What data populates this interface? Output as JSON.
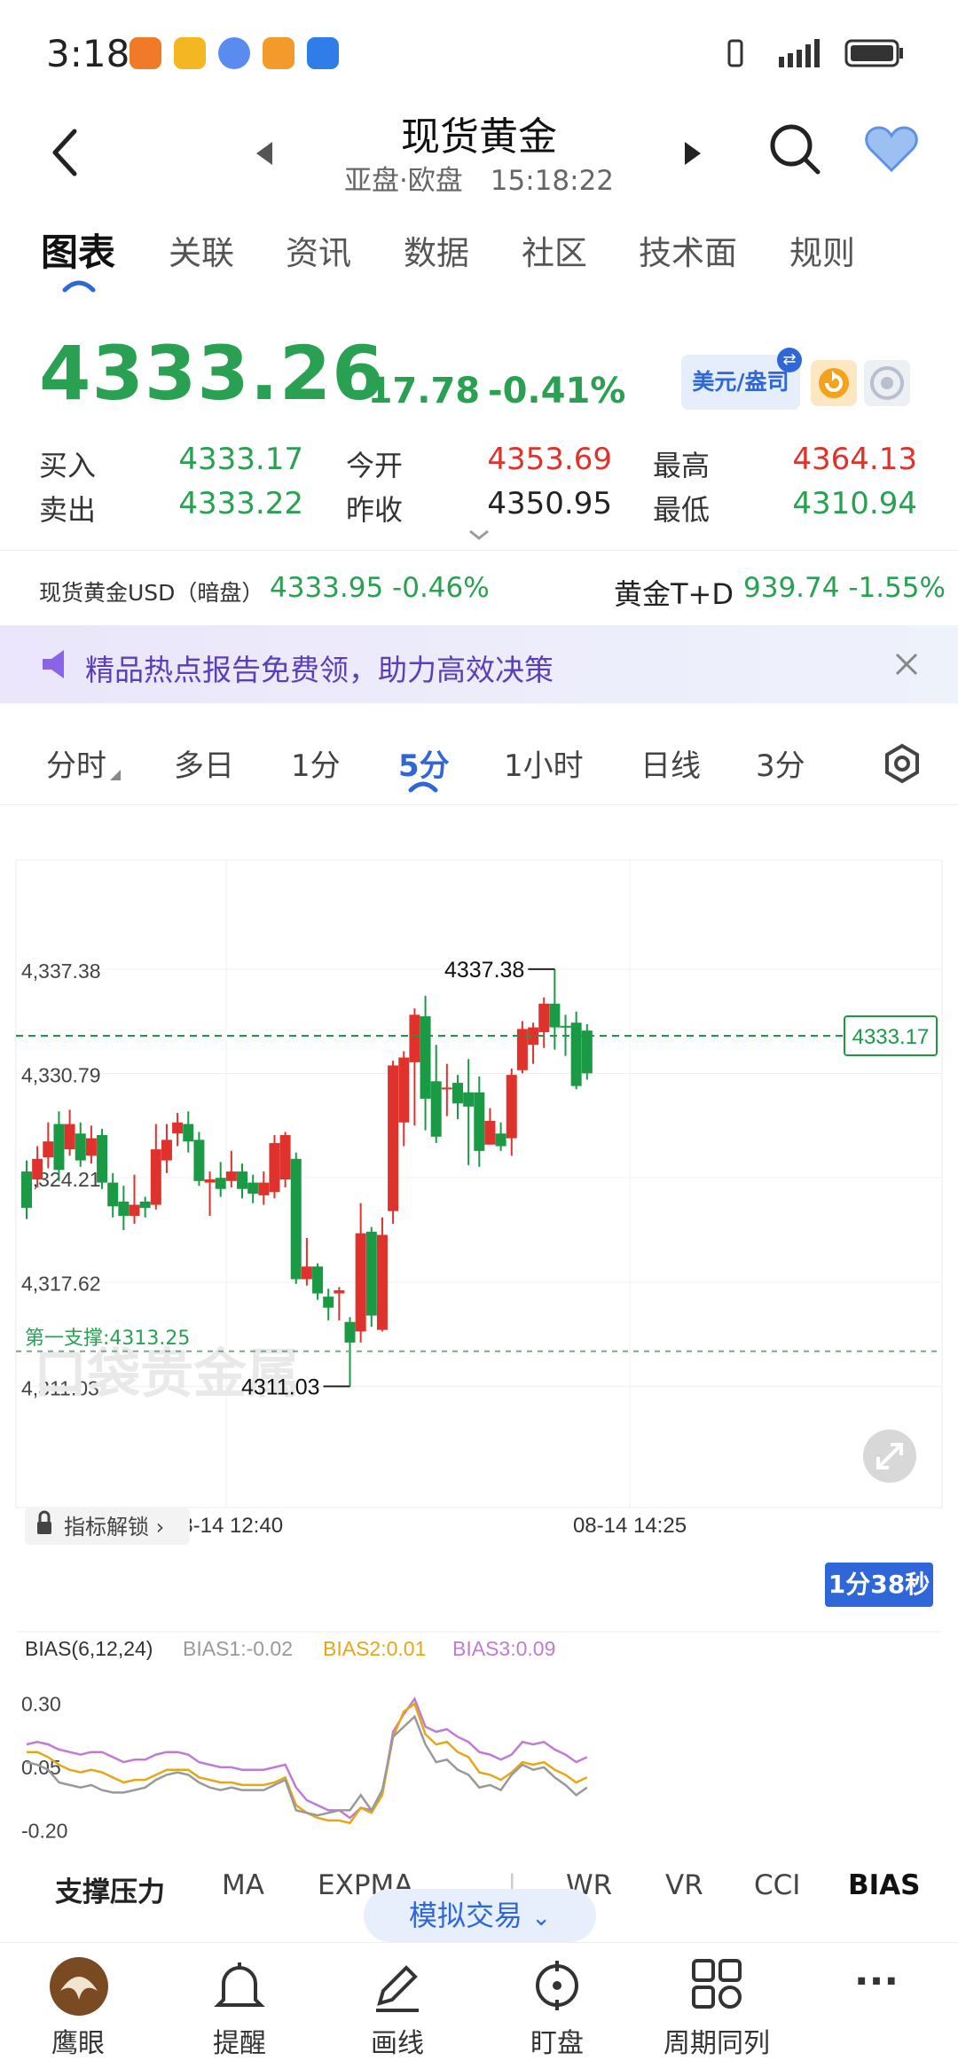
{
  "status": {
    "time": "3:18"
  },
  "header": {
    "title": "现货黄金",
    "subtitle": "亚盘·欧盘　15:18:22"
  },
  "tabs": [
    "图表",
    "关联",
    "资讯",
    "数据",
    "社区",
    "技术面",
    "规则"
  ],
  "quote": {
    "price": "4333.26",
    "change": "-17.78",
    "change_pct": "-0.41%",
    "currency_btn": "美元/盎司",
    "rows": [
      {
        "l1": "买入",
        "v1": "4333.17",
        "l2": "今开",
        "v2": "4353.69",
        "l3": "最高",
        "v3": "4364.13"
      },
      {
        "l1": "卖出",
        "v1": "4333.22",
        "l2": "昨收",
        "v2": "4350.95",
        "l3": "最低",
        "v3": "4310.94"
      }
    ]
  },
  "ref": {
    "left_label": "现货黄金USD（暗盘）",
    "left_value": "4333.95 -0.46%",
    "right_label": "黄金T+D",
    "right_value": "939.74 -1.55%"
  },
  "banner": {
    "text": "精品热点报告免费领，助力高效决策"
  },
  "periods": [
    "分时",
    "多日",
    "1分",
    "5分",
    "1小时",
    "日线",
    "3分"
  ],
  "chart_data": {
    "type": "candlestick",
    "y_ticks": [
      "4,337.38",
      "4,330.79",
      "4,324.21",
      "4,317.62",
      "4,311.03"
    ],
    "x_ticks": [
      "08-14 12:40",
      "08-14 14:25"
    ],
    "ylim": [
      4307.3,
      4340.9
    ],
    "current_price": "4333.17",
    "support_label": "第一支撑:4313.25",
    "support": 4313.25,
    "high_label": "4337.38",
    "high": 4337.38,
    "low_label": "4311.03",
    "low": 4311.03,
    "countdown": "1分38秒",
    "watermark": "口袋贵金属",
    "lock_label": "指标解锁",
    "candles": [
      [
        4324.6,
        4322.3,
        4325.3,
        4321.6
      ],
      [
        4324.1,
        4325.4,
        4326.2,
        4323.6
      ],
      [
        4325.5,
        4326.5,
        4327.7,
        4324.8
      ],
      [
        4327.6,
        4324.7,
        4328.4,
        4324.0
      ],
      [
        4326.0,
        4327.6,
        4328.5,
        4325.6
      ],
      [
        4327.0,
        4325.3,
        4327.7,
        4324.9
      ],
      [
        4325.6,
        4326.7,
        4327.5,
        4325.1
      ],
      [
        4326.9,
        4323.9,
        4327.3,
        4323.5
      ],
      [
        4323.9,
        4322.4,
        4324.5,
        4321.7
      ],
      [
        4322.7,
        4321.8,
        4323.7,
        4320.9
      ],
      [
        4321.8,
        4322.5,
        4324.4,
        4321.3
      ],
      [
        4322.7,
        4322.3,
        4323.0,
        4321.7
      ],
      [
        4322.5,
        4326.0,
        4327.6,
        4322.2
      ],
      [
        4325.3,
        4326.6,
        4327.6,
        4324.5
      ],
      [
        4327.0,
        4327.7,
        4328.3,
        4326.2
      ],
      [
        4327.6,
        4326.5,
        4328.4,
        4325.8
      ],
      [
        4326.6,
        4324.0,
        4327.1,
        4323.7
      ],
      [
        4323.9,
        4324.1,
        4324.6,
        4321.8
      ],
      [
        4324.2,
        4323.5,
        4325.2,
        4323.0
      ],
      [
        4324.0,
        4324.6,
        4325.9,
        4323.6
      ],
      [
        4324.6,
        4323.5,
        4325.1,
        4322.9
      ],
      [
        4323.9,
        4323.2,
        4324.4,
        4322.6
      ],
      [
        4323.1,
        4323.9,
        4324.6,
        4322.5
      ],
      [
        4323.3,
        4326.4,
        4326.9,
        4322.9
      ],
      [
        4324.1,
        4326.9,
        4327.1,
        4323.6
      ],
      [
        4325.4,
        4317.8,
        4325.8,
        4317.5
      ],
      [
        4317.8,
        4318.6,
        4320.4,
        4317.4
      ],
      [
        4318.6,
        4316.9,
        4318.8,
        4316.5
      ],
      [
        4316.7,
        4316.0,
        4317.2,
        4315.2
      ],
      [
        4316.9,
        4317.1,
        4317.3,
        4315.2
      ],
      [
        4315.1,
        4313.8,
        4315.4,
        4311.03
      ],
      [
        4314.5,
        4320.7,
        4322.6,
        4313.8
      ],
      [
        4320.8,
        4315.5,
        4321.1,
        4314.8
      ],
      [
        4314.6,
        4320.6,
        4321.7,
        4314.5
      ],
      [
        4322.1,
        4331.3,
        4331.6,
        4321.3
      ],
      [
        4327.7,
        4331.8,
        4332.2,
        4326.2
      ],
      [
        4331.5,
        4334.5,
        4334.9,
        4327.5
      ],
      [
        4334.4,
        4329.2,
        4335.7,
        4327.2
      ],
      [
        4330.3,
        4326.8,
        4332.6,
        4326.4
      ],
      [
        4329.8,
        4329.9,
        4331.4,
        4328.1
      ],
      [
        4330.2,
        4328.9,
        4330.7,
        4327.9
      ],
      [
        4329.6,
        4328.7,
        4331.7,
        4325.0
      ],
      [
        4329.6,
        4325.9,
        4330.6,
        4324.9
      ],
      [
        4326.3,
        4327.8,
        4328.6,
        4326.3
      ],
      [
        4327.0,
        4326.2,
        4327.7,
        4325.9
      ],
      [
        4326.7,
        4330.7,
        4331.1,
        4325.6
      ],
      [
        4331.0,
        4333.6,
        4334.1,
        4330.8
      ],
      [
        4332.6,
        4333.7,
        4334.0,
        4331.4
      ],
      [
        4333.4,
        4335.2,
        4335.6,
        4332.4
      ],
      [
        4335.2,
        4333.7,
        4337.38,
        4332.3
      ],
      [
        4333.8,
        4333.7,
        4334.5,
        4331.9
      ],
      [
        4334.0,
        4330.0,
        4334.7,
        4329.8
      ],
      [
        4333.5,
        4330.8,
        4333.9,
        4330.4
      ]
    ]
  },
  "bias": {
    "title": "BIAS(6,12,24)",
    "b1_label": "BIAS1:-0.02",
    "b2_label": "BIAS2:0.01",
    "b3_label": "BIAS3:0.09",
    "y_ticks": [
      "0.30",
      "0.05",
      "-0.20"
    ],
    "ylim": [
      -0.22,
      0.34
    ],
    "bias1": [
      0.07,
      0.06,
      0.04,
      -0.01,
      -0.02,
      -0.03,
      -0.02,
      -0.04,
      -0.05,
      -0.05,
      -0.04,
      -0.03,
      0.0,
      0.02,
      0.03,
      0.02,
      -0.01,
      -0.03,
      -0.04,
      -0.03,
      -0.04,
      -0.04,
      -0.04,
      -0.02,
      0.0,
      -0.12,
      -0.13,
      -0.14,
      -0.13,
      -0.12,
      -0.12,
      -0.06,
      -0.12,
      -0.04,
      0.17,
      0.21,
      0.25,
      0.14,
      0.07,
      0.08,
      0.04,
      0.02,
      -0.03,
      -0.02,
      -0.04,
      0.02,
      0.06,
      0.04,
      0.05,
      0.01,
      -0.02,
      -0.06,
      -0.03
    ],
    "bias2": [
      0.11,
      0.11,
      0.09,
      0.06,
      0.04,
      0.03,
      0.04,
      0.03,
      0.01,
      -0.01,
      0.0,
      0.0,
      0.02,
      0.04,
      0.04,
      0.04,
      0.01,
      0.0,
      -0.01,
      -0.01,
      -0.02,
      -0.02,
      -0.02,
      -0.01,
      0.01,
      -0.1,
      -0.13,
      -0.15,
      -0.16,
      -0.16,
      -0.17,
      -0.11,
      -0.13,
      -0.06,
      0.17,
      0.27,
      0.3,
      0.18,
      0.14,
      0.15,
      0.11,
      0.09,
      0.03,
      0.02,
      0.0,
      0.03,
      0.07,
      0.06,
      0.07,
      0.04,
      0.02,
      -0.01,
      0.01
    ],
    "bias3": [
      0.14,
      0.15,
      0.14,
      0.12,
      0.11,
      0.1,
      0.11,
      0.11,
      0.09,
      0.07,
      0.08,
      0.08,
      0.1,
      0.11,
      0.11,
      0.1,
      0.07,
      0.06,
      0.05,
      0.05,
      0.04,
      0.04,
      0.04,
      0.05,
      0.06,
      -0.03,
      -0.08,
      -0.1,
      -0.12,
      -0.12,
      -0.15,
      -0.11,
      -0.12,
      -0.06,
      0.19,
      0.26,
      0.32,
      0.21,
      0.19,
      0.2,
      0.17,
      0.15,
      0.11,
      0.1,
      0.08,
      0.1,
      0.15,
      0.14,
      0.15,
      0.12,
      0.1,
      0.07,
      0.09
    ]
  },
  "bottom_tools": {
    "items": [
      "支撑压力",
      "MA",
      "EXPMA",
      "|",
      "WR",
      "VR",
      "CCI",
      "BIAS"
    ],
    "sim_trade": "模拟交易"
  },
  "nav": [
    "鹰眼",
    "提醒",
    "画线",
    "盯盘",
    "周期同列",
    "···"
  ],
  "colors": {
    "up": "#e0322c",
    "down": "#1a9a45",
    "accent": "#2f66d8",
    "bias1": "#999999",
    "bias2": "#e6a717",
    "bias3": "#c07bd6"
  }
}
